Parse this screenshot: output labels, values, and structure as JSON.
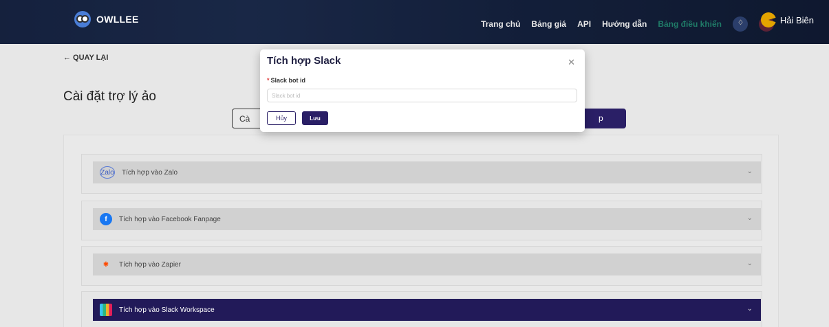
{
  "header": {
    "logo_text": "OWLLEE",
    "nav": [
      "Trang chủ",
      "Bảng giá",
      "API",
      "Hướng dẫn",
      "Bảng điều khiển"
    ],
    "user_name": "Hải Biên"
  },
  "page": {
    "back_label": "← QUAY LẠI",
    "title": "Cài đặt trợ lý ảo",
    "tab_left_partial": "Cà",
    "tab_right_partial": "p"
  },
  "integrations": [
    {
      "label": "Tích hợp vào Zalo",
      "icon": "zalo-icon",
      "active": false
    },
    {
      "label": "Tích hợp vào Facebook Fanpage",
      "icon": "facebook-icon",
      "active": false
    },
    {
      "label": "Tích hợp vào Zapier",
      "icon": "zapier-icon",
      "active": false
    },
    {
      "label": "Tích hợp vào Slack Workspace",
      "icon": "slack-icon",
      "active": true
    }
  ],
  "modal": {
    "title": "Tích hợp Slack",
    "field_label": "Slack bot id",
    "field_placeholder": "Slack bot id",
    "cancel_label": "Hủy",
    "save_label": "Lưu"
  },
  "colors": {
    "primary": "#2a1f66",
    "active_nav": "#1f7a67",
    "required": "#e03b3b"
  }
}
